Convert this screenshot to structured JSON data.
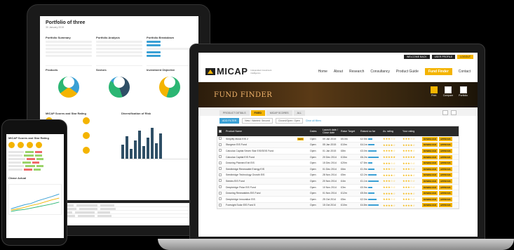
{
  "tablet": {
    "title": "Portfolio of three",
    "subtitle": "30 January 2015",
    "sections": [
      "Portfolio Summary",
      "Portfolio Analysis",
      "Portfolio Breakdown"
    ],
    "charts": [
      "Products",
      "Sectors",
      "Investment Objective"
    ],
    "lower": [
      "MICAP Scores and Star Rating",
      "Diversification of Risk"
    ]
  },
  "phone": {
    "title": "MICAP Scores and Star Rating",
    "chart_title": "Chase Actual"
  },
  "laptop": {
    "topbar": {
      "welcome": "WELCOME BACK",
      "user": "USER PROFILE",
      "logout": "LOGOUT"
    },
    "brand": {
      "name": "MICAP",
      "tagline": "Independent investment intelligence"
    },
    "nav": [
      "Home",
      "About",
      "Research",
      "Consultancy",
      "Product Guide",
      "Fund Finder",
      "Contact"
    ],
    "hero": {
      "title": "FUND FINDER",
      "tools": [
        "Print",
        "Compare",
        "Portfolio"
      ]
    },
    "tabs": [
      "PRODUCT DETAILS",
      "FIXED",
      "MICAP SCORES",
      "ALL"
    ],
    "filters": {
      "add": "ADD FILTER",
      "chip1": "New / Wanted: Second",
      "chip2": "Closed/Open: Open",
      "clear": "Clear all filters"
    },
    "columns": [
      "Product Name",
      "Dates",
      "Launch date / Close date",
      "Raise Target",
      "Raised so far",
      "Av. rating",
      "Your rating"
    ],
    "rows": [
      {
        "name": "Simplify Music EIS 2",
        "manager": "Simplify Music Fund Management",
        "badge": "NEW",
        "status": "Open",
        "launch": "09 Jan 2015",
        "target": "£5.0m",
        "raised": "£2.5m",
        "stars": "★★★☆☆",
        "action1": "DOWNLOAD",
        "action2": "APPROVE"
      },
      {
        "name": "Sturgeon EIS Fund",
        "manager": "Sturgeon Ventures / Enterprise Private Capital",
        "badge": "",
        "status": "Open",
        "launch": "05 Jan 2015",
        "target": "£10m",
        "raised": "£4.1m",
        "stars": "★★★★☆",
        "action1": "DOWNLOAD",
        "action2": "APPROVE"
      },
      {
        "name": "Calculus Capital Seven Star EIS/SEIS Fund",
        "manager": "Calculus Capital / Enterprise Partners",
        "badge": "",
        "status": "Open",
        "launch": "01 Jan 2015",
        "target": "£8m",
        "raised": "£3.0m",
        "stars": "★★★★☆",
        "action1": "DOWNLOAD",
        "action2": "APPROVE"
      },
      {
        "name": "Calculus Capital EIS Fund",
        "manager": "Calculus Capital",
        "badge": "",
        "status": "Open",
        "launch": "20 Dec 2014",
        "target": "£15m",
        "raised": "£6.2m",
        "stars": "★★★★★",
        "action1": "DOWNLOAD",
        "action2": "APPROVE"
      },
      {
        "name": "Downing Planned Exit EIS",
        "manager": "Downing LLP",
        "badge": "",
        "status": "Open",
        "launch": "15 Dec 2014",
        "target": "£20m",
        "raised": "£7.8m",
        "stars": "★★★☆☆",
        "action1": "DOWNLOAD",
        "action2": "APPROVE"
      },
      {
        "name": "Seedbridge Renewable Energy EIS",
        "manager": "Seedbridge Ventures",
        "badge": "",
        "status": "Open",
        "launch": "01 Dec 2014",
        "target": "£6m",
        "raised": "£1.9m",
        "stars": "★★★☆☆",
        "action1": "DOWNLOAD",
        "action2": "APPROVE"
      },
      {
        "name": "Seedbridge Technology Growth EIS",
        "manager": "Seedbridge Ventures",
        "badge": "",
        "status": "Open",
        "launch": "28 Nov 2014",
        "target": "£5m",
        "raised": "£2.2m",
        "stars": "★★★★☆",
        "action1": "DOWNLOAD",
        "action2": "APPROVE"
      },
      {
        "name": "Seedrs EIS Fund",
        "manager": "Seedrs Ltd",
        "badge": "",
        "status": "Open",
        "launch": "20 Nov 2014",
        "target": "£4m",
        "raised": "£1.1m",
        "stars": "★★★☆☆",
        "action1": "DOWNLOAD",
        "action2": "APPROVE"
      },
      {
        "name": "Deepbridge Polar EIS Fund",
        "manager": "Deepbridge Capital",
        "badge": "",
        "status": "Open",
        "launch": "10 Nov 2014",
        "target": "£3m",
        "raised": "£0.9m",
        "stars": "★★★☆☆",
        "action1": "DOWNLOAD",
        "action2": "APPROVE"
      },
      {
        "name": "Downing Renewables EIS Fund",
        "manager": "Downing LLP",
        "badge": "",
        "status": "Open",
        "launch": "01 Nov 2014",
        "target": "£12m",
        "raised": "£5.5m",
        "stars": "★★★★☆",
        "action1": "DOWNLOAD",
        "action2": "APPROVE"
      },
      {
        "name": "Deepbridge Innovation EIS",
        "manager": "Deepbridge Capital",
        "badge": "",
        "status": "Open",
        "launch": "25 Oct 2014",
        "target": "£5m",
        "raised": "£2.0m",
        "stars": "★★★☆☆",
        "action1": "DOWNLOAD",
        "action2": "APPROVE"
      },
      {
        "name": "Foresight Solar EIS Fund 5",
        "manager": "Foresight Group",
        "badge": "",
        "status": "Open",
        "launch": "15 Oct 2014",
        "target": "£10m",
        "raised": "£4.8m",
        "stars": "★★★★☆",
        "action1": "DOWNLOAD",
        "action2": "APPROVE"
      }
    ]
  },
  "colors": {
    "accent": "#f4b400",
    "blue": "#3aa0d5",
    "green": "#2bb673",
    "dark": "#2f4f66"
  }
}
